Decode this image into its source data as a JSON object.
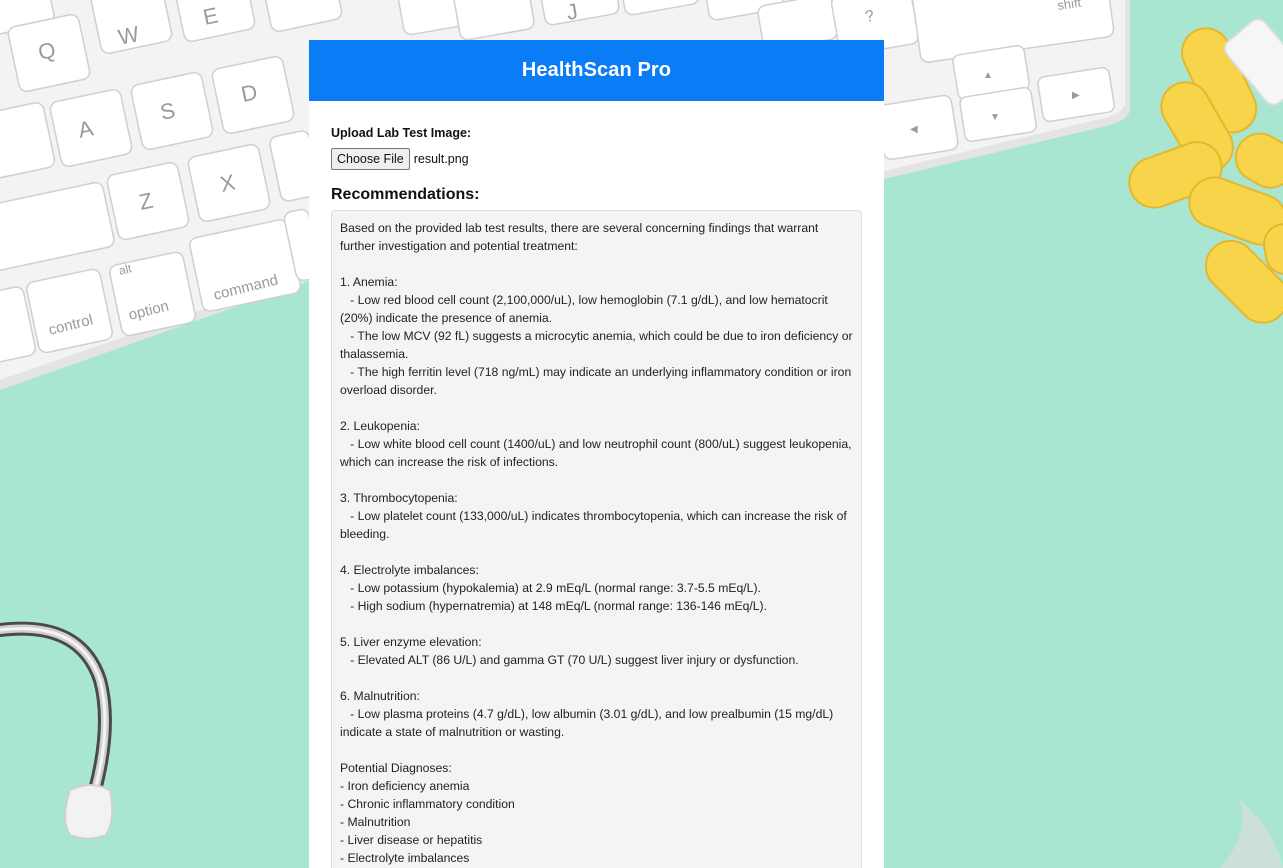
{
  "app": {
    "title": "HealthScan Pro"
  },
  "upload": {
    "label": "Upload Lab Test Image:",
    "button_label": "Choose File",
    "file_name": "result.png"
  },
  "recommendations": {
    "heading": "Recommendations:",
    "text": "Based on the provided lab test results, there are several concerning findings that warrant further investigation and potential treatment:\n\n1. Anemia:\n   - Low red blood cell count (2,100,000/uL), low hemoglobin (7.1 g/dL), and low hematocrit (20%) indicate the presence of anemia.\n   - The low MCV (92 fL) suggests a microcytic anemia, which could be due to iron deficiency or thalassemia.\n   - The high ferritin level (718 ng/mL) may indicate an underlying inflammatory condition or iron overload disorder.\n\n2. Leukopenia:\n   - Low white blood cell count (1400/uL) and low neutrophil count (800/uL) suggest leukopenia, which can increase the risk of infections.\n\n3. Thrombocytopenia:\n   - Low platelet count (133,000/uL) indicates thrombocytopenia, which can increase the risk of bleeding.\n\n4. Electrolyte imbalances:\n   - Low potassium (hypokalemia) at 2.9 mEq/L (normal range: 3.7-5.5 mEq/L).\n   - High sodium (hypernatremia) at 148 mEq/L (normal range: 136-146 mEq/L).\n\n5. Liver enzyme elevation:\n   - Elevated ALT (86 U/L) and gamma GT (70 U/L) suggest liver injury or dysfunction.\n\n6. Malnutrition:\n   - Low plasma proteins (4.7 g/dL), low albumin (3.01 g/dL), and low prealbumin (15 mg/dL) indicate a state of malnutrition or wasting.\n\nPotential Diagnoses:\n- Iron deficiency anemia\n- Chronic inflammatory condition\n- Malnutrition\n- Liver disease or hepatitis\n- Electrolyte imbalances"
  },
  "colors": {
    "header_bg": "#0a7cf5",
    "page_bg": "#a9e6d2",
    "pill_yellow": "#f7d44a"
  },
  "background_keyboard_keys": {
    "q": "Q",
    "w": "W",
    "e": "E",
    "a": "A",
    "s": "S",
    "d": "D",
    "z": "Z",
    "x": "X",
    "j": "J",
    "question": "?",
    "shift": "shift",
    "control": "control",
    "alt": "alt",
    "option": "option",
    "command": "command"
  }
}
